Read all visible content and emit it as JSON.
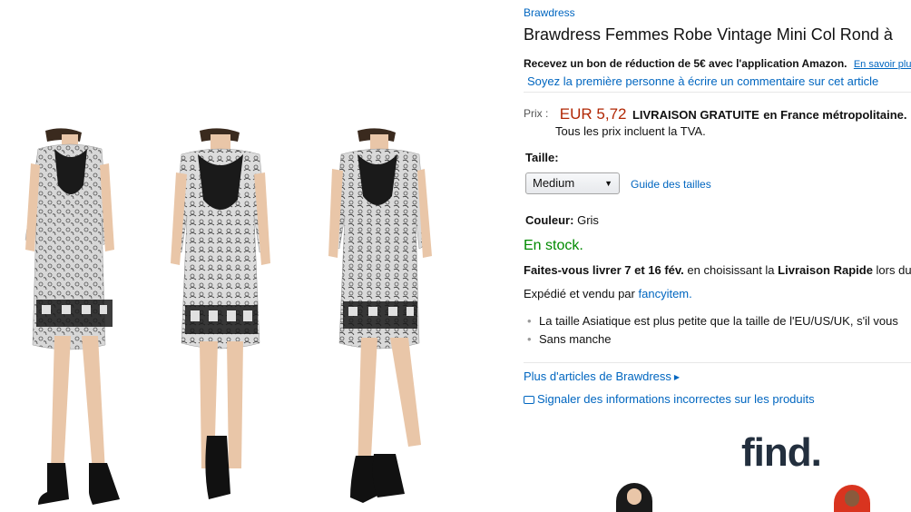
{
  "product": {
    "brand": "Brawdress",
    "title": "Brawdress Femmes Robe Vintage Mini Col Rond à",
    "promo_text": "Recevez un bon de réduction de 5€ avec l'application Amazon.",
    "promo_link": "En savoir plu",
    "review_link": "Soyez la première personne à écrire un commentaire sur cet article"
  },
  "price": {
    "label": "Prix :",
    "value": "EUR 5,72",
    "shipping_bold": "LIVRAISON GRATUITE",
    "shipping_rest": "en France métropolitaine.",
    "vat_note": "Tous les prix incluent la TVA."
  },
  "size": {
    "label": "Taille:",
    "selected": "Medium",
    "guide_link": "Guide des tailles"
  },
  "color": {
    "label": "Couleur:",
    "value": "Gris"
  },
  "stock": "En stock.",
  "delivery": {
    "bold_1": "Faites-vous livrer 7 et 16 fév.",
    "middle": "en choisissant la",
    "bold_2": "Livraison Rapide",
    "tail": "lors du"
  },
  "sold_by": {
    "prefix": "Expédié et vendu par",
    "seller": "fancyitem."
  },
  "bullets": [
    "La taille Asiatique est plus petite que la taille de l'EU/US/UK, s'il vous",
    "Sans manche"
  ],
  "links": {
    "more_from_brand": "Plus d'articles de Brawdress",
    "report": "Signaler des informations incorrectes sur les produits"
  },
  "ad": {
    "logo_text": "find."
  },
  "colors": {
    "link": "#0066c0",
    "price": "#b12704",
    "in_stock": "#008a00"
  }
}
